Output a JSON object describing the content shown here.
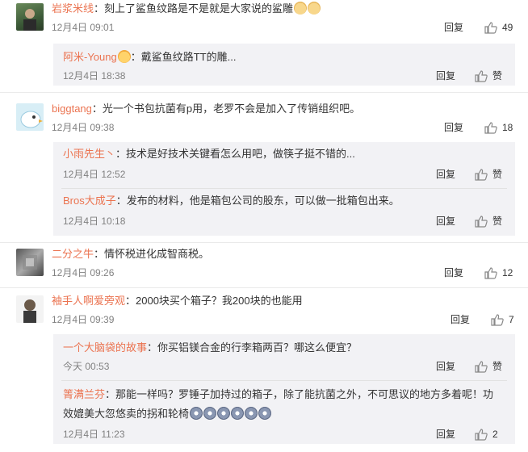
{
  "comments": [
    {
      "user": "岩浆米线",
      "text": "：刻上了鲨鱼纹路是不是就是大家说的鲨雕",
      "emojis": [
        "doge-emoji",
        "doge-emoji"
      ],
      "time": "12月4日 09:01",
      "reply_label": "回复",
      "likes": "49",
      "replies": [
        {
          "user": "阿米-Young",
          "text": "：戴鲨鱼纹路TT的雕...",
          "time": "12月4日 18:38",
          "reply_label": "回复",
          "likes": "赞"
        }
      ]
    },
    {
      "user": "biggtang",
      "text": "：光一个书包抗菌有p用，老罗不会是加入了传销组织吧。",
      "time": "12月4日 09:38",
      "reply_label": "回复",
      "likes": "18",
      "replies": [
        {
          "user": "小雨先生丶",
          "text": "：技术是好技术关键看怎么用吧，做筷子挺不错的...",
          "time": "12月4日 12:52",
          "reply_label": "回复",
          "likes": "赞"
        },
        {
          "user": "Bros大成子",
          "text": "：发布的材料，他是箱包公司的股东，可以做一批箱包出来。",
          "time": "12月4日 10:18",
          "reply_label": "回复",
          "likes": "赞"
        }
      ]
    },
    {
      "user": "二分之牛",
      "text": "：情怀税进化成智商税。",
      "time": "12月4日 09:26",
      "reply_label": "回复",
      "likes": "12",
      "replies": []
    },
    {
      "user": "袖手人啊爱旁观",
      "text": "：2000块买个箱子？我200块的也能用",
      "time": "12月4日 09:39",
      "reply_label": "回复",
      "likes": "7",
      "replies": [
        {
          "user": "一个大脑袋的故事",
          "text": "：你买铝镁合金的行李箱两百？哪这么便宜？",
          "time": "今天 00:53",
          "reply_label": "回复",
          "likes": "赞"
        },
        {
          "user": "箐满兰芬",
          "text": "：那能一样吗？罗锤子加持过的箱子，除了能抗菌之外，不可思议的地方多着呢！功",
          "text2": "效媲美大忽悠卖的拐和轮椅",
          "emojis": [
            "shock-emoji",
            "shock-emoji",
            "shock-emoji",
            "shock-emoji",
            "shock-emoji",
            "shock-emoji"
          ],
          "time": "12月4日 11:23",
          "reply_label": "回复",
          "likes": "2"
        }
      ]
    }
  ],
  "colors": {
    "username": "#eb7350",
    "reply_bg": "#f2f2f5",
    "meta": "#808080"
  }
}
